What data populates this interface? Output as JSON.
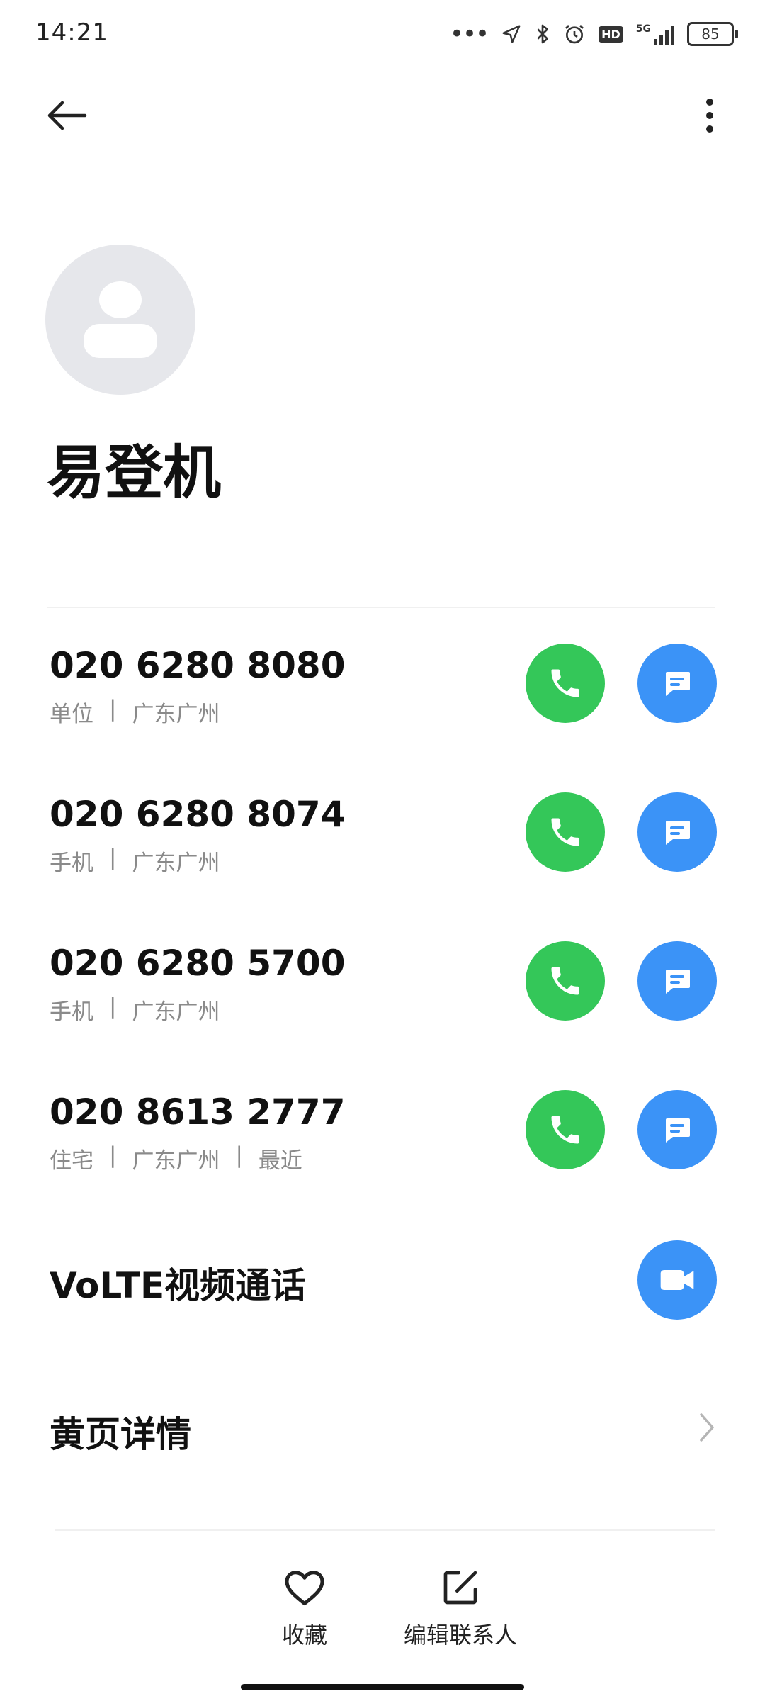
{
  "status_bar": {
    "time": "14:21",
    "network": "5G",
    "hd": "HD",
    "battery": "85"
  },
  "contact": {
    "name": "易登机"
  },
  "phones": [
    {
      "number": "020 6280 8080",
      "type": "单位",
      "location": "广东广州",
      "extra": ""
    },
    {
      "number": "020 6280 8074",
      "type": "手机",
      "location": "广东广州",
      "extra": ""
    },
    {
      "number": "020 6280 5700",
      "type": "手机",
      "location": "广东广州",
      "extra": ""
    },
    {
      "number": "020 8613 2777",
      "type": "住宅",
      "location": "广东广州",
      "extra": "最近"
    }
  ],
  "separator": "|",
  "volte": {
    "label": "VoLTE视频通话"
  },
  "yellow_pages": {
    "label": "黄页详情"
  },
  "bottom_nav": {
    "favorite_label": "收藏",
    "edit_label": "编辑联系人"
  },
  "colors": {
    "call_green": "#34c759",
    "message_blue": "#3b93f7",
    "avatar_gray": "#e6e7eb"
  }
}
